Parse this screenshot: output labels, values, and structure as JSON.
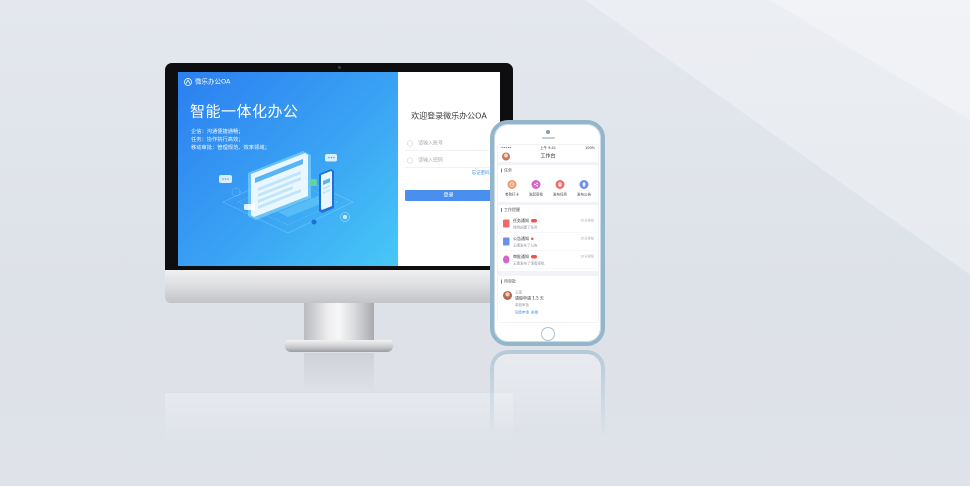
{
  "colors": {
    "brand_blue": "#4a8ff0",
    "panel_gradient_start": "#2b7ff0",
    "panel_gradient_end": "#48c8f6",
    "phone_frame": "#93b6cb",
    "badge_red": "#f0524f"
  },
  "monitor": {
    "app_name": "微乐办公OA",
    "logo_icon": "logo-icon",
    "headline": "智能一体化办公",
    "features": [
      "企信：沟通便捷通畅；",
      "任务：协作执行高效；",
      "移动审批：管理规范、效率领域；"
    ],
    "login": {
      "welcome": "欢迎登录微乐办公OA",
      "account_placeholder": "请输入账号",
      "account_icon": "user-icon",
      "password_placeholder": "请输入密码",
      "password_icon": "lock-icon",
      "forgot": "忘记密码?",
      "submit": "登录"
    }
  },
  "phone": {
    "status": {
      "carrier": "•••••",
      "time": "上午 9:41",
      "battery": "100%"
    },
    "title": "工作台",
    "task_section": "任务",
    "quick_actions": [
      {
        "label": "考勤打卡",
        "color": "#f39a6b",
        "icon": "clock-icon"
      },
      {
        "label": "发起审批",
        "color": "#d466c8",
        "icon": "share-icon"
      },
      {
        "label": "发布任务",
        "color": "#f06a6a",
        "icon": "document-icon"
      },
      {
        "label": "发布公告",
        "color": "#6d8ff0",
        "icon": "megaphone-icon"
      }
    ],
    "reminder_section": "工作提醒",
    "reminders": [
      {
        "title": "任务通知",
        "subtitle": "徐明创建了任务",
        "time": "10分钟前",
        "color": "#f06a6a",
        "icon": "task-doc-icon"
      },
      {
        "title": "公告通知",
        "subtitle": "王康发布了公告",
        "time": "10分钟前",
        "color": "#6d8ff0",
        "icon": "notice-doc-icon"
      },
      {
        "title": "审批通知",
        "subtitle": "王康发布了请假审批",
        "time": "10分钟前",
        "color": "#d466c8",
        "icon": "approval-share-icon"
      }
    ],
    "approval_section": "待审批",
    "approval": {
      "name": "王康",
      "title": "请假申请 1.5 天",
      "type": "事假审批",
      "actions": "同意申请  拒绝"
    }
  }
}
